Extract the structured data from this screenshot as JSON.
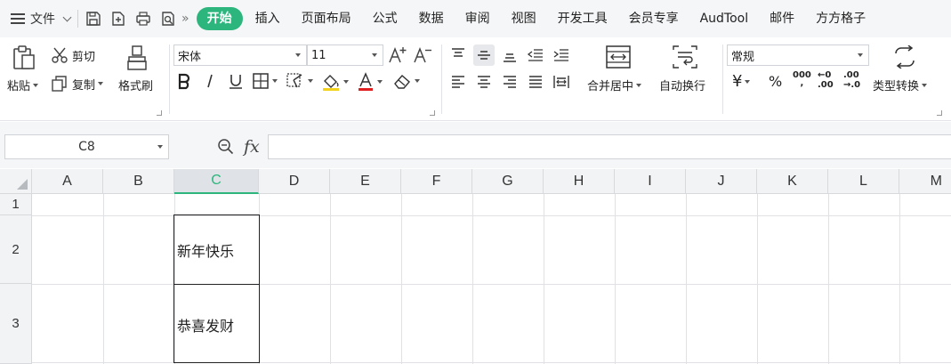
{
  "menubar": {
    "file_label": "文件",
    "tabs": [
      {
        "label": "开始",
        "active": true
      },
      {
        "label": "插入"
      },
      {
        "label": "页面布局"
      },
      {
        "label": "公式"
      },
      {
        "label": "数据"
      },
      {
        "label": "审阅"
      },
      {
        "label": "视图"
      },
      {
        "label": "开发工具"
      },
      {
        "label": "会员专享"
      },
      {
        "label": "AudTool"
      },
      {
        "label": "邮件"
      },
      {
        "label": "方方格子"
      }
    ],
    "accent_color": "#2cb67d"
  },
  "ribbon": {
    "clipboard": {
      "paste": "粘贴",
      "cut": "剪切",
      "copy": "复制",
      "format_painter": "格式刷"
    },
    "font": {
      "font_name": "宋体",
      "font_size": "11"
    },
    "alignment": {
      "merge_center": "合并居中",
      "wrap_text": "自动换行"
    },
    "number": {
      "format": "常规",
      "currency_symbol": "¥",
      "percent_symbol": "%",
      "thousands_symbol": "000",
      "inc_decimal_top": "←0",
      "inc_decimal_bottom": ".00",
      "dec_decimal_top": ".00",
      "dec_decimal_bottom": "→.0",
      "type_convert": "类型转换"
    }
  },
  "formula_bar": {
    "name_box": "C8",
    "fx": "fx",
    "formula": ""
  },
  "sheet": {
    "columns": [
      "A",
      "B",
      "C",
      "D",
      "E",
      "F",
      "G",
      "H",
      "I",
      "J",
      "K",
      "L",
      "M"
    ],
    "active_column": "C",
    "rows": [
      "1",
      "2",
      "3"
    ],
    "cells": {
      "C2": "新年快乐",
      "C3": "恭喜发财"
    }
  }
}
